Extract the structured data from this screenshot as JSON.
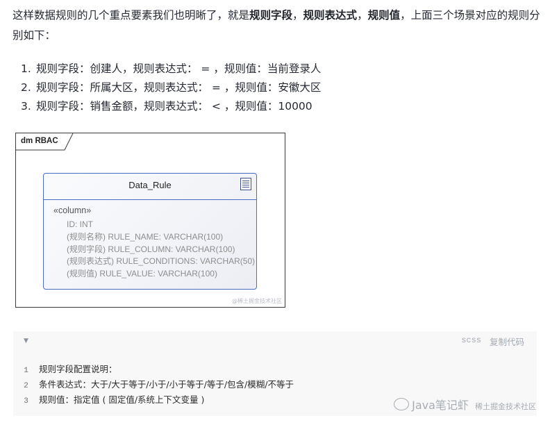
{
  "intro": {
    "part1": "这样数据规则的几个重点要素我们也明晰了，就是",
    "bold1": "规则字段",
    "sep1": "，",
    "bold2": "规则表达式",
    "sep2": "，",
    "bold3": "规则值",
    "part2": "，上面三个场景对应的规则分别如下："
  },
  "rules": [
    {
      "num": "1.",
      "text": "规则字段：创建人，规则表达式： = ，规则值：当前登录人"
    },
    {
      "num": "2.",
      "text": "规则字段：所属大区，规则表达式： = ，规则值：安徽大区"
    },
    {
      "num": "3.",
      "text": "规则字段：销售金额，规则表达式： < ，规则值：10000"
    }
  ],
  "diagram": {
    "frame_title": "dm RBAC",
    "entity_name": "Data_Rule",
    "table_icon": "table-icon",
    "stereotype": "«column»",
    "attributes": [
      "ID: INT",
      "(规则名称) RULE_NAME: VARCHAR(100)",
      "(规则字段) RULE_COLUMN: VARCHAR(100)",
      "(规则表达式) RULE_CONDITIONS: VARCHAR(50)",
      "(规则值) RULE_VALUE: VARCHAR(100)"
    ],
    "watermark": "@稀土掘金技术社区"
  },
  "code": {
    "caret_icon": "chevron-down-icon",
    "lang": "scss",
    "copy_label": "复制代码",
    "lines": [
      {
        "n": "1",
        "text": "规则字段配置说明："
      },
      {
        "n": "2",
        "text": "条件表达式：大于/大于等于/小于/小于等于/等于/包含/模糊/不等于"
      },
      {
        "n": "3",
        "text": "规则值：指定值 ( 固定值/系统上下文变量 )"
      }
    ]
  },
  "watermark": {
    "icon": "wechat-icon",
    "text": "Java笔记虾",
    "subtext": "稀土掘金技术社区"
  }
}
